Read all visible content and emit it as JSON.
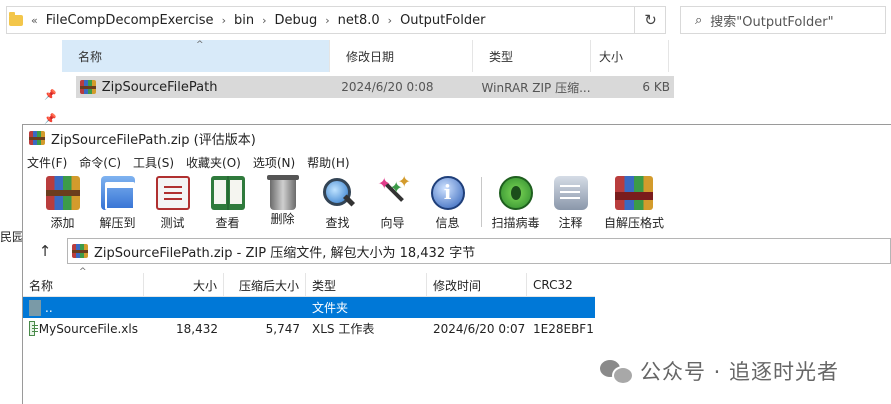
{
  "explorer": {
    "breadcrumb": [
      "FileCompDecompExercise",
      "bin",
      "Debug",
      "net8.0",
      "OutputFolder"
    ],
    "search_placeholder": "搜索\"OutputFolder\"",
    "columns": {
      "name": "名称",
      "date": "修改日期",
      "type": "类型",
      "size": "大小"
    },
    "row": {
      "name": "ZipSourceFilePath",
      "date": "2024/6/20 0:08",
      "type": "WinRAR ZIP 压缩...",
      "size": "6 KB"
    },
    "left_fragment": "民园抽"
  },
  "winrar": {
    "title": "ZipSourceFilePath.zip (评估版本)",
    "menu": [
      "文件(F)",
      "命令(C)",
      "工具(S)",
      "收藏夹(O)",
      "选项(N)",
      "帮助(H)"
    ],
    "toolbar": {
      "add": "添加",
      "extract": "解压到",
      "test": "测试",
      "view": "查看",
      "delete": "删除",
      "find": "查找",
      "wizard": "向导",
      "info": "信息",
      "scan": "扫描病毒",
      "comment": "注释",
      "sfx": "自解压格式"
    },
    "path": "ZipSourceFilePath.zip - ZIP 压缩文件, 解包大小为 18,432 字节",
    "columns": {
      "name": "名称",
      "size": "大小",
      "packed": "压缩后大小",
      "type": "类型",
      "modified": "修改时间",
      "crc": "CRC32"
    },
    "rows": [
      {
        "name": "..",
        "size": "",
        "packed": "",
        "type": "文件夹",
        "modified": "",
        "crc": ""
      },
      {
        "name": "MySourceFile.xls",
        "size": "18,432",
        "packed": "5,747",
        "type": "XLS 工作表",
        "modified": "2024/6/20 0:07",
        "crc": "1E28EBF1"
      }
    ]
  },
  "watermark": "公众号 · 追逐时光者"
}
